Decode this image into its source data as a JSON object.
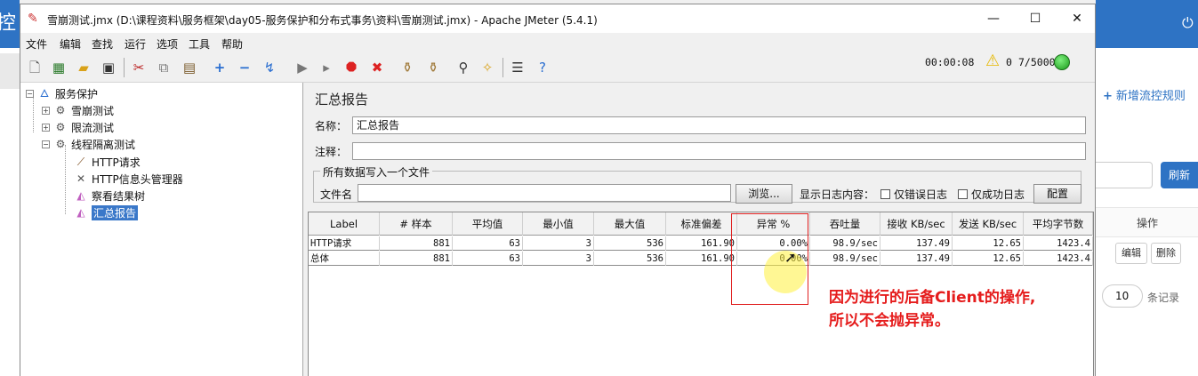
{
  "bg_app": {
    "header_text": "控",
    "add_rule": "新增流控规则",
    "refresh": "刷新",
    "col_op": "操作",
    "edit": "编辑",
    "delete": "删除",
    "page_size": "10",
    "page_size_label": "条记录"
  },
  "window": {
    "title": "雪崩测试.jmx (D:\\课程资料\\服务框架\\day05-服务保护和分布式事务\\资料\\雪崩测试.jmx) - Apache JMeter (5.4.1)",
    "min": "—",
    "max": "☐",
    "close": "✕"
  },
  "menu": [
    "文件",
    "编辑",
    "查找",
    "运行",
    "选项",
    "工具",
    "帮助"
  ],
  "status": {
    "elapsed": "00:00:08",
    "warnings": "0",
    "threads": "7/5000"
  },
  "tree": {
    "root": "服务保护",
    "n1": "雪崩测试",
    "n2": "限流测试",
    "n3": "线程隔离测试",
    "c1": "HTTP请求",
    "c2": "HTTP信息头管理器",
    "c3": "察看结果树",
    "c4": "汇总报告"
  },
  "panel": {
    "title": "汇总报告",
    "name_label": "名称：",
    "name_value": "汇总报告",
    "comment_label": "注释：",
    "file_section": "所有数据写入一个文件",
    "file_label": "文件名",
    "browse": "浏览...",
    "log_label": "显示日志内容：",
    "errors_only": "仅错误日志",
    "success_only": "仅成功日志",
    "configure": "配置"
  },
  "table": {
    "headers": [
      "Label",
      "# 样本",
      "平均值",
      "最小值",
      "最大值",
      "标准偏差",
      "异常 %",
      "吞吐量",
      "接收 KB/sec",
      "发送 KB/sec",
      "平均字节数"
    ],
    "rows": [
      [
        "HTTP请求",
        "881",
        "63",
        "3",
        "536",
        "161.90",
        "0.00%",
        "98.9/sec",
        "137.49",
        "12.65",
        "1423.4"
      ],
      [
        "总体",
        "881",
        "63",
        "3",
        "536",
        "161.90",
        "0.00%",
        "98.9/sec",
        "137.49",
        "12.65",
        "1423.4"
      ]
    ]
  },
  "annotation": {
    "line1": "因为进行的后备Client的操作,",
    "line2": "所以不会抛异常。"
  }
}
